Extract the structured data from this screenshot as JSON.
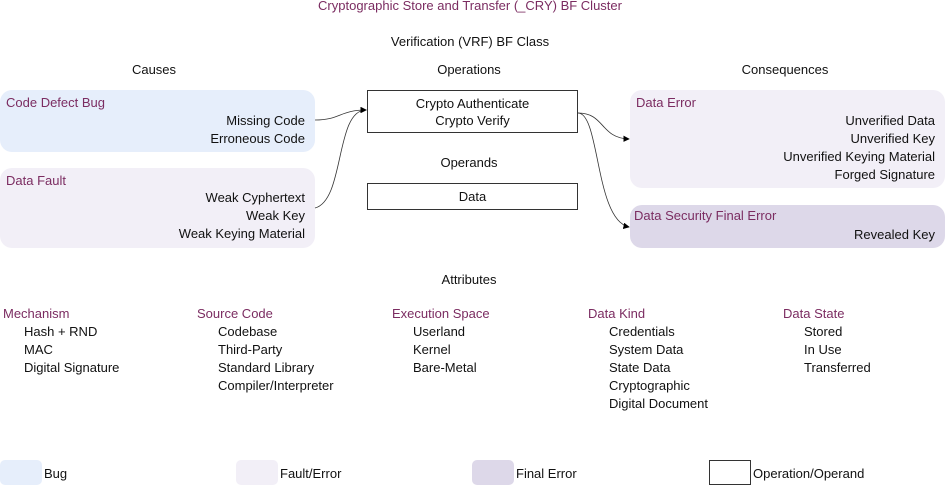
{
  "title": "Cryptographic Store and Transfer (_CRY) BF Cluster",
  "class_title": "Verification (VRF) BF Class",
  "headers": {
    "causes": "Causes",
    "operations": "Operations",
    "consequences": "Consequences",
    "operands": "Operands",
    "attributes": "Attributes"
  },
  "causes": [
    {
      "title": "Code Defect Bug",
      "items": [
        "Missing Code",
        "Erroneous Code"
      ]
    },
    {
      "title": "Data Fault",
      "items": [
        "Weak Cyphertext",
        "Weak Key",
        "Weak Keying Material"
      ]
    }
  ],
  "operations": [
    "Crypto Authenticate",
    "Crypto Verify"
  ],
  "operands": [
    "Data"
  ],
  "consequences": [
    {
      "title": "Data Error",
      "items": [
        "Unverified Data",
        "Unverified Key",
        "Unverified Keying Material",
        "Forged Signature"
      ]
    },
    {
      "title": "Data Security Final Error",
      "items": [
        "Revealed Key"
      ]
    }
  ],
  "attributes": [
    {
      "title": "Mechanism",
      "items": [
        "Hash + RND",
        "MAC",
        "Digital Signature"
      ]
    },
    {
      "title": "Source Code",
      "items": [
        "Codebase",
        "Third-Party",
        "Standard Library",
        "Compiler/Interpreter"
      ]
    },
    {
      "title": "Execution Space",
      "items": [
        "Userland",
        "Kernel",
        "Bare-Metal"
      ]
    },
    {
      "title": "Data Kind",
      "items": [
        "Credentials",
        "System Data",
        "State Data",
        "Cryptographic",
        "Digital Document"
      ]
    },
    {
      "title": "Data State",
      "items": [
        "Stored",
        "In Use",
        "Transferred"
      ]
    }
  ],
  "legend": [
    "Bug",
    "Fault/Error",
    "Final Error",
    "Operation/Operand"
  ],
  "colors": {
    "accent": "#7b2c61",
    "bug": "#e6eefb",
    "fault": "#f2eff7",
    "final": "#ddd8e9"
  }
}
